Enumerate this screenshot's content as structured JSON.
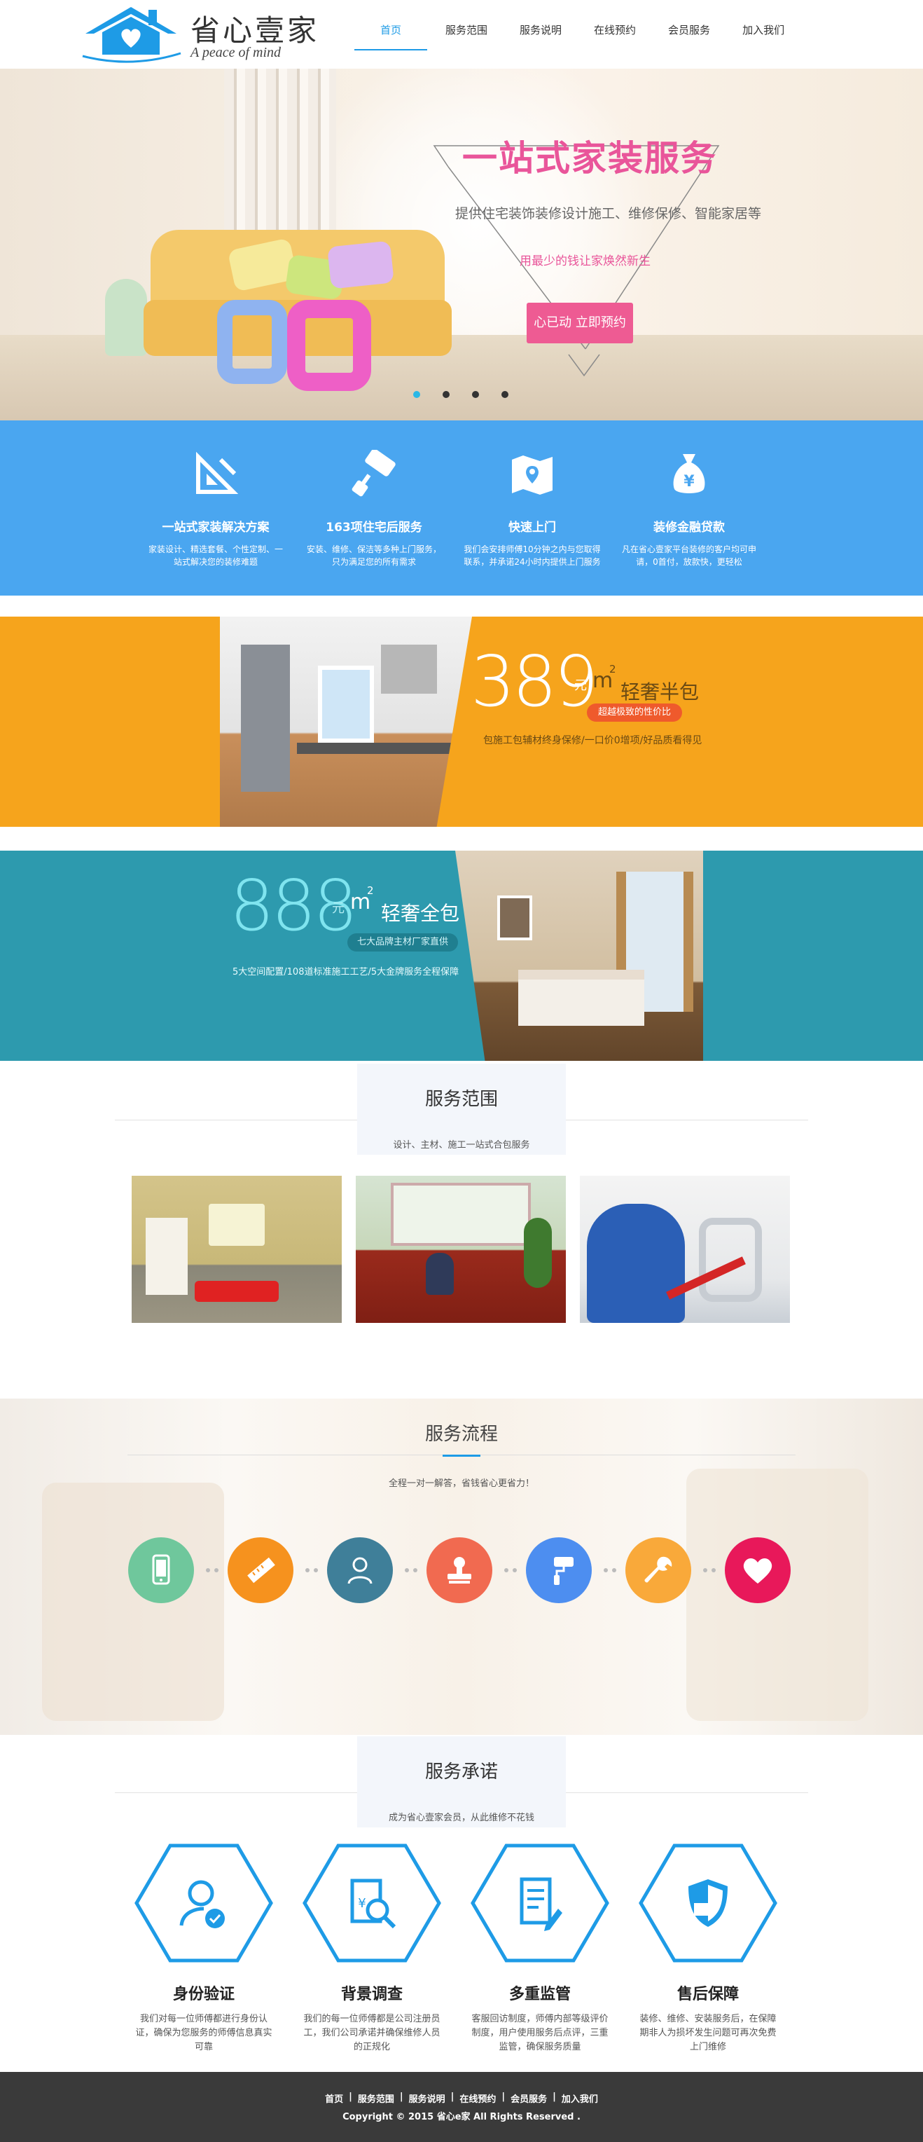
{
  "brand": {
    "name": "省心壹家",
    "slogan": "A peace of mind",
    "accent_color": "#1e9be6",
    "logo_icon": "house-heart-icon"
  },
  "nav": {
    "items": [
      {
        "label": "首页",
        "active": true
      },
      {
        "label": "服务范围",
        "active": false
      },
      {
        "label": "服务说明",
        "active": false
      },
      {
        "label": "在线预约",
        "active": false
      },
      {
        "label": "会员服务",
        "active": false
      },
      {
        "label": "加入我们",
        "active": false
      }
    ]
  },
  "hero": {
    "title": "一站式家装服务",
    "subtitle": "提供住宅装饰装修设计施工、维修保修、智能家居等",
    "tagline": "用最少的钱让家焕然新生",
    "cta": "心已动 立即预约",
    "slides": 4,
    "active_slide": 1,
    "title_color": "#e9559a"
  },
  "features": {
    "background": "#4aa6f0",
    "items": [
      {
        "icon": "set-square-icon",
        "title": "一站式家装解决方案",
        "desc": "家装设计、精选套餐、个性定制、一站式解决您的装修难题"
      },
      {
        "icon": "paint-roller-icon",
        "title": "163项住宅后服务",
        "desc": "安装、维修、保洁等多种上门服务，只为满足您的所有需求"
      },
      {
        "icon": "map-pin-icon",
        "title": "快速上门",
        "desc": "我们会安排师傅10分钟之内与您取得联系，并承诺24小时内提供上门服务"
      },
      {
        "icon": "money-bag-icon",
        "title": "装修金融贷款",
        "desc": "凡在省心壹家平台装修的客户均可申请，0首付，放款快，更轻松"
      }
    ]
  },
  "offer1": {
    "price": "389",
    "yuan": "元",
    "unit": "m",
    "unit_sup": "2",
    "label": "轻奢半包",
    "tag": "超越极致的性价比",
    "desc": "包施工包辅材终身保修/一口价0增项/好品质看得见",
    "background": "#f6a41c"
  },
  "offer2": {
    "price": "888",
    "yuan": "元",
    "unit": "m",
    "unit_sup": "2",
    "label": "轻奢全包",
    "tag": "七大品牌主材厂家直供",
    "desc": "5大空间配置/108道标准施工工艺/5大金牌服务全程保障",
    "background": "#2d9aae"
  },
  "scope": {
    "title": "服务范围",
    "subtitle": "设计、主材、施工一站式合包服务"
  },
  "process": {
    "title": "服务流程",
    "subtitle": "全程一对一解答，省钱省心更省力！",
    "steps": [
      {
        "icon": "phone-icon",
        "color": "#6fc79c"
      },
      {
        "icon": "ruler-icon",
        "color": "#f6921e"
      },
      {
        "icon": "person-icon",
        "color": "#3f7f99"
      },
      {
        "icon": "stamp-icon",
        "color": "#f16a50"
      },
      {
        "icon": "paint-roller-icon",
        "color": "#4d8ef0"
      },
      {
        "icon": "wrench-icon",
        "color": "#f9a93a"
      },
      {
        "icon": "heart-icon",
        "color": "#e8185a"
      }
    ]
  },
  "promise": {
    "title": "服务承诺",
    "subtitle": "成为省心壹家会员，从此维修不花钱",
    "items": [
      {
        "icon": "id-verified-icon",
        "title": "身份验证",
        "desc": "我们对每一位师傅都进行身份认证，确保为您服务的师傅信息真实可靠"
      },
      {
        "icon": "background-check-icon",
        "title": "背景调查",
        "desc": "我们的每一位师傅都是公司注册员工，我们公司承诺并确保维修人员的正规化"
      },
      {
        "icon": "document-supervision-icon",
        "title": "多重监管",
        "desc": "客服回访制度，师傅内部等级评价制度，用户使用服务后点评，三重监管，确保服务质量"
      },
      {
        "icon": "shield-icon",
        "title": "售后保障",
        "desc": "装修、维修、安装服务后，在保障期非人为损坏发生问题可再次免费上门维修"
      }
    ]
  },
  "footer": {
    "links": [
      "首页",
      "服务范围",
      "服务说明",
      "在线预约",
      "会员服务",
      "加入我们"
    ],
    "separator": "|",
    "copyright": "Copyright © 2015 省心e家 All Rights Reserved ."
  }
}
